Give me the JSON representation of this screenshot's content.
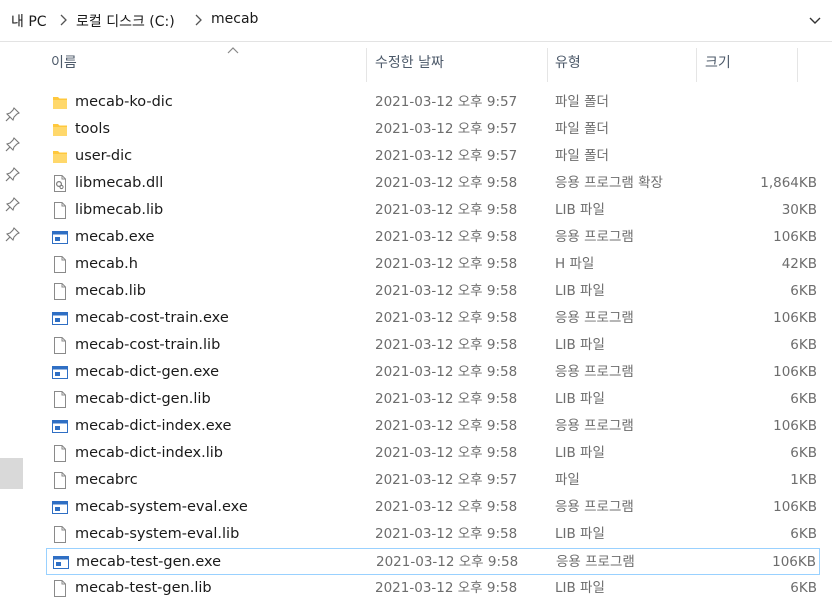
{
  "breadcrumb": [
    "내 PC",
    "로컬 디스크 (C:)",
    "mecab"
  ],
  "columns": {
    "name": "이름",
    "date": "수정한 날짜",
    "type": "유형",
    "size": "크기"
  },
  "files": [
    {
      "name": "mecab-ko-dic",
      "date": "2021-03-12 오후 9:57",
      "type": "파일 폴더",
      "size": "",
      "icon": "folder-icon",
      "selected": false
    },
    {
      "name": "tools",
      "date": "2021-03-12 오후 9:57",
      "type": "파일 폴더",
      "size": "",
      "icon": "folder-icon",
      "selected": false
    },
    {
      "name": "user-dic",
      "date": "2021-03-12 오후 9:57",
      "type": "파일 폴더",
      "size": "",
      "icon": "folder-icon",
      "selected": false
    },
    {
      "name": "libmecab.dll",
      "date": "2021-03-12 오후 9:58",
      "type": "응용 프로그램 확장",
      "size": "1,864KB",
      "icon": "dll-file-icon",
      "selected": false
    },
    {
      "name": "libmecab.lib",
      "date": "2021-03-12 오후 9:58",
      "type": "LIB 파일",
      "size": "30KB",
      "icon": "file-icon",
      "selected": false
    },
    {
      "name": "mecab.exe",
      "date": "2021-03-12 오후 9:58",
      "type": "응용 프로그램",
      "size": "106KB",
      "icon": "exe-icon",
      "selected": false
    },
    {
      "name": "mecab.h",
      "date": "2021-03-12 오후 9:58",
      "type": "H 파일",
      "size": "42KB",
      "icon": "file-icon",
      "selected": false
    },
    {
      "name": "mecab.lib",
      "date": "2021-03-12 오후 9:58",
      "type": "LIB 파일",
      "size": "6KB",
      "icon": "file-icon",
      "selected": false
    },
    {
      "name": "mecab-cost-train.exe",
      "date": "2021-03-12 오후 9:58",
      "type": "응용 프로그램",
      "size": "106KB",
      "icon": "exe-icon",
      "selected": false
    },
    {
      "name": "mecab-cost-train.lib",
      "date": "2021-03-12 오후 9:58",
      "type": "LIB 파일",
      "size": "6KB",
      "icon": "file-icon",
      "selected": false
    },
    {
      "name": "mecab-dict-gen.exe",
      "date": "2021-03-12 오후 9:58",
      "type": "응용 프로그램",
      "size": "106KB",
      "icon": "exe-icon",
      "selected": false
    },
    {
      "name": "mecab-dict-gen.lib",
      "date": "2021-03-12 오후 9:58",
      "type": "LIB 파일",
      "size": "6KB",
      "icon": "file-icon",
      "selected": false
    },
    {
      "name": "mecab-dict-index.exe",
      "date": "2021-03-12 오후 9:58",
      "type": "응용 프로그램",
      "size": "106KB",
      "icon": "exe-icon",
      "selected": false
    },
    {
      "name": "mecab-dict-index.lib",
      "date": "2021-03-12 오후 9:58",
      "type": "LIB 파일",
      "size": "6KB",
      "icon": "file-icon",
      "selected": false
    },
    {
      "name": "mecabrc",
      "date": "2021-03-12 오후 9:57",
      "type": "파일",
      "size": "1KB",
      "icon": "file-icon",
      "selected": false
    },
    {
      "name": "mecab-system-eval.exe",
      "date": "2021-03-12 오후 9:58",
      "type": "응용 프로그램",
      "size": "106KB",
      "icon": "exe-icon",
      "selected": false
    },
    {
      "name": "mecab-system-eval.lib",
      "date": "2021-03-12 오후 9:58",
      "type": "LIB 파일",
      "size": "6KB",
      "icon": "file-icon",
      "selected": false
    },
    {
      "name": "mecab-test-gen.exe",
      "date": "2021-03-12 오후 9:58",
      "type": "응용 프로그램",
      "size": "106KB",
      "icon": "exe-icon",
      "selected": true
    },
    {
      "name": "mecab-test-gen.lib",
      "date": "2021-03-12 오후 9:58",
      "type": "LIB 파일",
      "size": "6KB",
      "icon": "file-icon",
      "selected": false
    }
  ],
  "colors": {
    "folder": "#ffc83d",
    "selection_border": "#99d1ff",
    "exe_blue": "#2f6fc4"
  }
}
